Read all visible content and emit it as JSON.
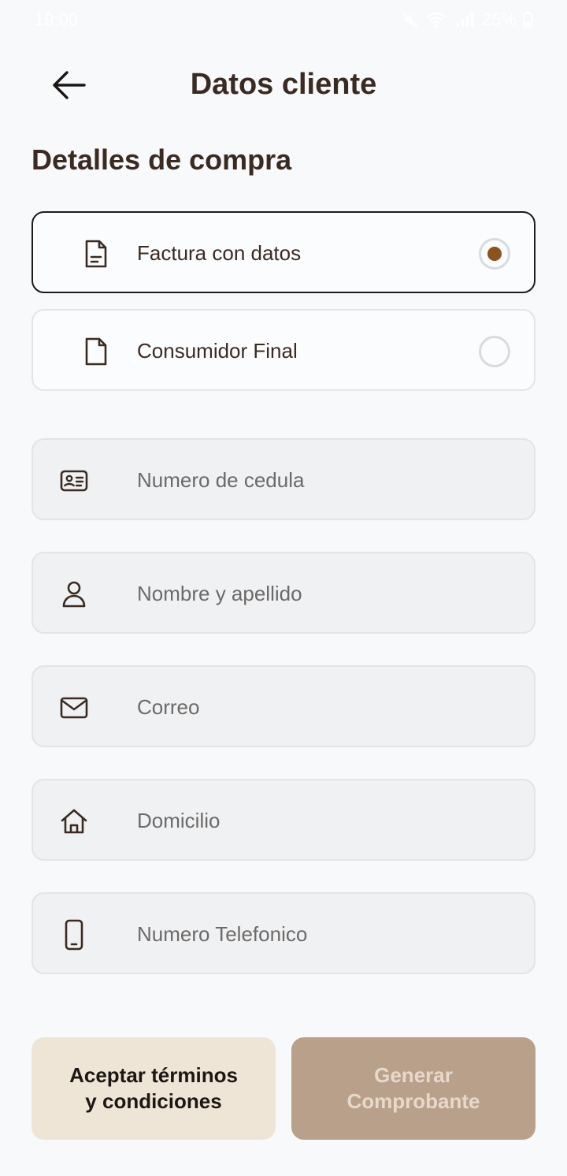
{
  "status_bar": {
    "time": "19:00",
    "battery": "25%"
  },
  "header": {
    "title": "Datos cliente"
  },
  "section": {
    "title": "Detalles de compra"
  },
  "options": [
    {
      "label": "Factura con datos",
      "icon": "document-lines-icon",
      "selected": true
    },
    {
      "label": "Consumidor Final",
      "icon": "document-icon",
      "selected": false
    }
  ],
  "fields": {
    "cedula": {
      "placeholder": "Numero de cedula",
      "value": "",
      "icon": "id-card-icon"
    },
    "nombre": {
      "placeholder": "Nombre y apellido",
      "value": "",
      "icon": "user-icon"
    },
    "correo": {
      "placeholder": "Correo",
      "value": "",
      "icon": "mail-icon"
    },
    "domicilio": {
      "placeholder": "Domicilio",
      "value": "",
      "icon": "home-icon"
    },
    "telefono": {
      "placeholder": "Numero Telefonico",
      "value": "",
      "icon": "phone-icon"
    }
  },
  "buttons": {
    "terms_line1": "Aceptar términos",
    "terms_line2": "y condiciones",
    "generate_line1": "Generar",
    "generate_line2": "Comprobante"
  },
  "colors": {
    "background": "#F7F9FB",
    "accent_radio": "#8B531E",
    "terms_button": "#EFE5D6",
    "generate_button_disabled": "#B9A08A",
    "title_text": "#3B2A21"
  }
}
